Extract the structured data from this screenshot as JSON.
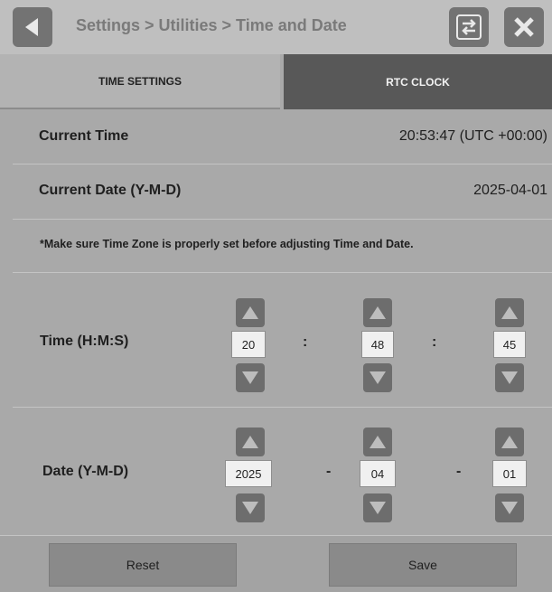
{
  "header": {
    "title": "Settings > Utilities > Time and Date",
    "back_icon": "back-arrow-icon",
    "swap_icon": "swap-arrows-icon",
    "close_icon": "close-icon"
  },
  "tabs": [
    {
      "label": "TIME SETTINGS",
      "active": false
    },
    {
      "label": "RTC CLOCK",
      "active": true
    }
  ],
  "current_time": {
    "label": "Current Time",
    "value": "20:53:47 (UTC +00:00)"
  },
  "current_date": {
    "label": "Current Date (Y-M-D)",
    "value": "2025-04-01"
  },
  "note": "*Make sure Time Zone is properly set before adjusting Time and Date.",
  "time_row": {
    "label": "Time (H:M:S)",
    "hours": "20",
    "minutes": "48",
    "seconds": "45",
    "separator": ":"
  },
  "date_row": {
    "label": "Date (Y-M-D)",
    "year": "2025",
    "month": "04",
    "day": "01",
    "separator": "-"
  },
  "footer": {
    "reset_label": "Reset",
    "save_label": "Save"
  },
  "colors": {
    "background": "#a9a9a9",
    "active_tab": "#585858",
    "button": "#8a8a8a"
  }
}
